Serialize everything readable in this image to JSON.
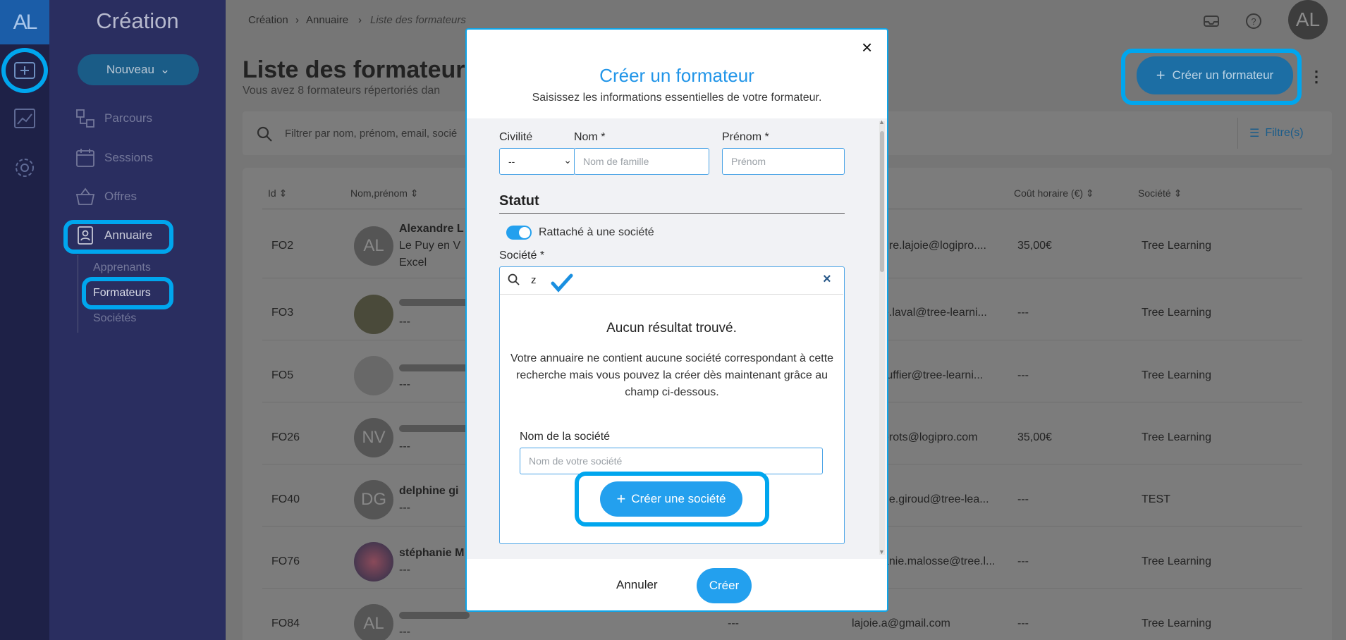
{
  "app": {
    "logo_text": "AL",
    "section_title": "Création",
    "avatar_initials": "AL"
  },
  "sidebar": {
    "new_button": "Nouveau",
    "items": [
      {
        "label": "Parcours",
        "icon": "flow-icon"
      },
      {
        "label": "Sessions",
        "icon": "calendar-icon"
      },
      {
        "label": "Offres",
        "icon": "basket-icon"
      },
      {
        "label": "Annuaire",
        "icon": "contact-book-icon"
      }
    ],
    "subitems": [
      "Apprenants",
      "Formateurs",
      "Sociétés"
    ]
  },
  "breadcrumb": [
    "Création",
    "Annuaire",
    "Liste des formateurs"
  ],
  "page": {
    "title": "Liste des formateurs",
    "subtitle": "Vous avez 8 formateurs répertoriés dan",
    "create_button": "Créer un formateur",
    "filter_placeholder": "Filtrer par nom, prénom, email, socié",
    "filters_label": "Filtre(s)"
  },
  "table": {
    "headers": [
      "Id",
      "Nom,prénom",
      "Coût horaire (€)",
      "Société"
    ],
    "rows": [
      {
        "id": "FO2",
        "avatar": "AL",
        "name": "Alexandre L",
        "detail": "Le Puy en V",
        "detail2": "Excel",
        "email": "dre.lajoie@logipro....",
        "cost": "35,00€",
        "company": "Tree Learning"
      },
      {
        "id": "FO3",
        "avatar": "",
        "name": "",
        "detail": "---",
        "detail2": "",
        "email": "e.laval@tree-learni...",
        "cost": "---",
        "company": "Tree Learning"
      },
      {
        "id": "FO5",
        "avatar": "",
        "name": "",
        "detail": "---",
        "detail2": "",
        "email": "ruffier@tree-learni...",
        "cost": "---",
        "company": "Tree Learning"
      },
      {
        "id": "FO26",
        "avatar": "NV",
        "name": "",
        "detail": "---",
        "detail2": "",
        "email": "erots@logipro.com",
        "cost": "35,00€",
        "company": "Tree Learning"
      },
      {
        "id": "FO40",
        "avatar": "DG",
        "name": "delphine gi",
        "detail": "---",
        "detail2": "",
        "email": "ne.giroud@tree-lea...",
        "cost": "---",
        "company": "TEST"
      },
      {
        "id": "FO76",
        "avatar": "",
        "name": "stéphanie M",
        "detail": "---",
        "detail2": "",
        "email": "anie.malosse@tree.l...",
        "cost": "---",
        "company": "Tree Learning"
      },
      {
        "id": "FO84",
        "avatar": "AL",
        "name": "",
        "detail": "---",
        "detail2": "",
        "email": "lajoie.a@gmail.com",
        "cost": "---",
        "company": "Tree Learning",
        "extra": "---"
      }
    ]
  },
  "modal": {
    "title": "Créer un formateur",
    "subtitle": "Saisissez les informations essentielles de votre formateur.",
    "civilite_label": "Civilité",
    "civilite_value": "--",
    "nom_label": "Nom *",
    "nom_placeholder": "Nom de famille",
    "prenom_label": "Prénom *",
    "prenom_placeholder": "Prénom",
    "statut_heading": "Statut",
    "toggle_label": "Rattaché à une société",
    "societe_label": "Société *",
    "search_value": "z",
    "no_result_title": "Aucun résultat trouvé.",
    "no_result_text": "Votre annuaire ne contient aucune société correspondant à cette recherche mais vous pouvez la créer dès maintenant grâce au champ ci-dessous.",
    "company_name_label": "Nom de la société",
    "company_name_placeholder": "Nom de votre société",
    "create_company_button": "Créer une société",
    "cancel_button": "Annuler",
    "submit_button": "Créer"
  },
  "colors": {
    "accent": "#23a0ee",
    "highlight": "#00a6ee",
    "rail": "#1e2147",
    "sidebar": "#2a2e60"
  }
}
